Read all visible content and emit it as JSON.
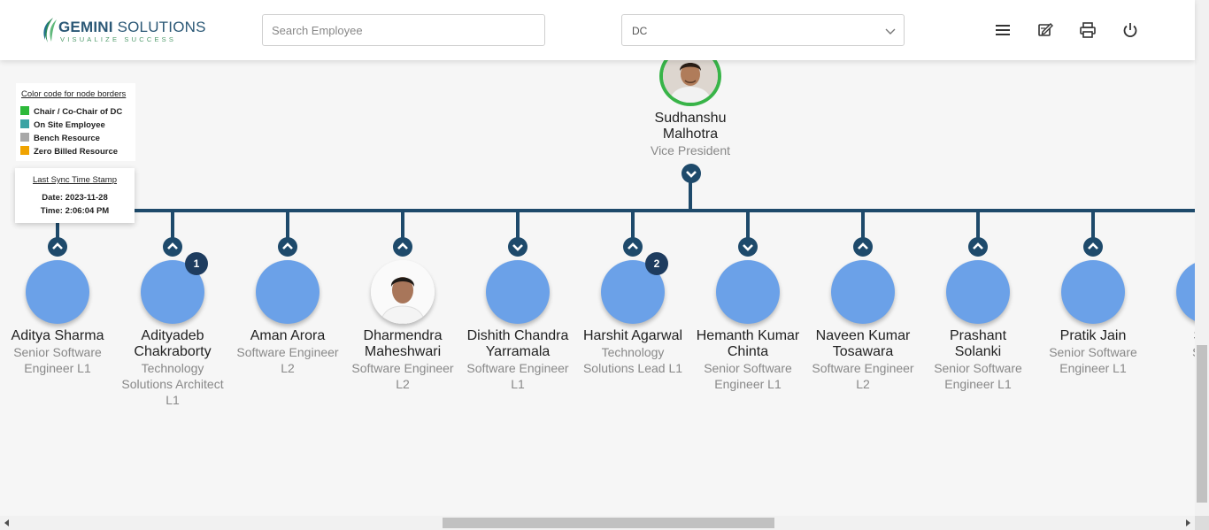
{
  "header": {
    "logo": {
      "brand_bold": "GEMINI",
      "brand_rest": "SOLUTIONS",
      "tagline": "VISUALIZE SUCCESS"
    },
    "search": {
      "placeholder": "Search Employee",
      "value": ""
    },
    "dropdown": {
      "selected": "DC"
    },
    "icons": [
      "menu-icon",
      "edit-icon",
      "print-icon",
      "power-icon"
    ]
  },
  "legend": {
    "title": "Color code for node borders",
    "items": [
      {
        "label": "Chair / Co-Chair of DC",
        "color": "#2db93a"
      },
      {
        "label": "On Site Employee",
        "color": "#3aa3a3"
      },
      {
        "label": "Bench Resource",
        "color": "#a8a8a8"
      },
      {
        "label": "Zero Billed Resource",
        "color": "#f0a300"
      }
    ]
  },
  "sync": {
    "title": "Last Sync Time Stamp",
    "date": "Date: 2023-11-28",
    "time": "Time: 2:06:04 PM"
  },
  "root": {
    "name_line1": "Sudhanshu",
    "name_line2": "Malhotra",
    "role": "Vice President",
    "border_color": "#38b448"
  },
  "children": [
    {
      "name": [
        "Aditya Sharma"
      ],
      "role": [
        "Senior Software",
        "Engineer L1"
      ],
      "toggle": "up"
    },
    {
      "name": [
        "Adityadeb",
        "Chakraborty"
      ],
      "role": [
        "Technology",
        "Solutions Architect",
        "L1"
      ],
      "toggle": "up",
      "badge": "1"
    },
    {
      "name": [
        "Aman Arora"
      ],
      "role": [
        "Software Engineer",
        "L2"
      ],
      "toggle": "up"
    },
    {
      "name": [
        "Dharmendra",
        "Maheshwari"
      ],
      "role": [
        "Software Engineer",
        "L2"
      ],
      "toggle": "up",
      "photo": true
    },
    {
      "name": [
        "Dishith Chandra",
        "Yarramala"
      ],
      "role": [
        "Software Engineer",
        "L1"
      ],
      "toggle": "down"
    },
    {
      "name": [
        "Harshit Agarwal"
      ],
      "role": [
        "Technology",
        "Solutions Lead L1"
      ],
      "toggle": "up",
      "badge": "2"
    },
    {
      "name": [
        "Hemanth Kumar",
        "Chinta"
      ],
      "role": [
        "Senior Software",
        "Engineer L1"
      ],
      "toggle": "down"
    },
    {
      "name": [
        "Naveen Kumar",
        "Tosawara"
      ],
      "role": [
        "Software Engineer",
        "L2"
      ],
      "toggle": "up"
    },
    {
      "name": [
        "Prashant",
        "Solanki"
      ],
      "role": [
        "Senior Software",
        "Engineer L1"
      ],
      "toggle": "up"
    },
    {
      "name": [
        "Pratik Jain"
      ],
      "role": [
        "Senior Software",
        "Engineer L1"
      ],
      "toggle": "up"
    },
    {
      "name": [
        "Sum"
      ],
      "role": [
        "Senio",
        "Eng"
      ],
      "toggle": "none"
    }
  ],
  "colors": {
    "connector": "#1e4a6b",
    "node_fill": "#6ba1e8",
    "badge": "#1e3c5f"
  }
}
